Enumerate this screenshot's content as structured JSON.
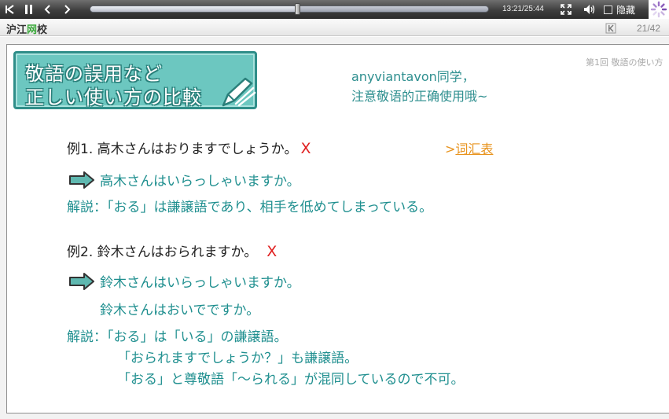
{
  "player": {
    "time": "13:21/25:44",
    "progress": 0.52,
    "hide_label": "隐藏"
  },
  "logo": {
    "part1": "沪江",
    "part2": "网",
    "part3": "校"
  },
  "page_counter": "21/42",
  "slide": {
    "title_line1": "敬語の誤用など",
    "title_line2": "正しい使い方の比較",
    "greeting_line1": "anyviantavon同学，",
    "greeting_line2": "注意敬语的正确使用哦~",
    "chapter_note": "第1回  敬語の使い方",
    "vocab_link_prefix": ">",
    "vocab_link_text": "词汇表",
    "ex1": {
      "text": "例1. 高木さんはおりますでしょうか。",
      "mark": "X",
      "answer": "高木さんはいらっしゃいますか。",
      "explain": "解説：「おる」は謙譲語であり、相手を低めてしまっている。"
    },
    "ex2": {
      "text": "例2. 鈴木さんはおられますか。",
      "mark": "X",
      "answer1": "鈴木さんはいらっしゃいますか。",
      "answer2": "鈴木さんはおいでですか。",
      "explain1": "解説：「おる」は「いる」の謙譲語。",
      "explain2": "「おられますでしょうか？」も謙譲語。",
      "explain3": "「おる」と尊敬語「～られる」が混同しているので不可。"
    }
  },
  "colors": {
    "teal_text": "#1f8f8f",
    "mark_red": "#e02020",
    "link_orange": "#e8931d",
    "banner": "#6cc7c0"
  }
}
